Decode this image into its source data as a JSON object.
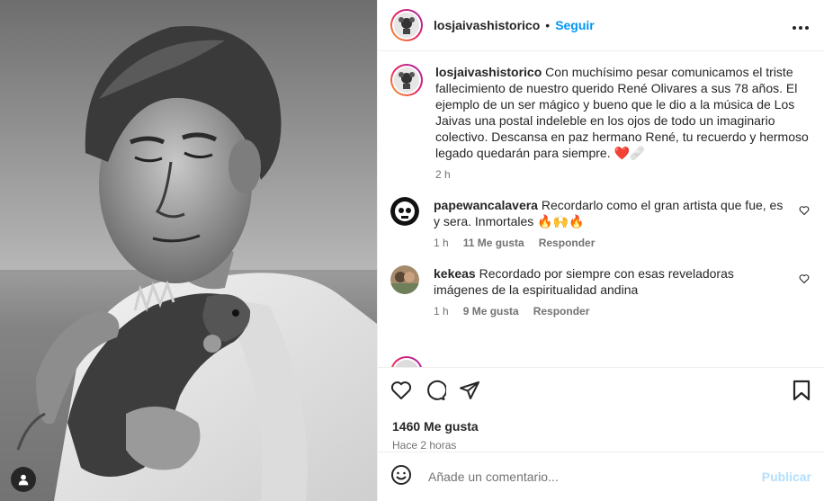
{
  "post": {
    "author": "losjaivashistorico",
    "follow_label": "Seguir",
    "separator": "•",
    "caption": "Con muchísimo pesar comunicamos el triste fallecimiento de nuestro querido René Olivares a sus 78 años. El ejemplo de un ser mágico y bueno que le dio a la música de Los Jaivas una postal indeleble en los ojos de todo un imaginario colectivo. Descansa en paz hermano René, tu recuerdo y hermoso legado quedarán para siempre. ❤️🩹",
    "caption_time": "2 h"
  },
  "comments": [
    {
      "user": "papewancalavera",
      "text": "Recordarlo como el gran artista que fue, es y sera. Inmortales 🔥🙌🔥",
      "time": "1 h",
      "likes": "11 Me gusta",
      "reply": "Responder"
    },
    {
      "user": "kekeas",
      "text": "Recordado por siempre con esas reveladoras imágenes de la espiritualidad andina",
      "time": "1 h",
      "likes": "9 Me gusta",
      "reply": "Responder"
    }
  ],
  "stats": {
    "likes": "1460 Me gusta",
    "posted": "Hace 2 horas"
  },
  "composer": {
    "placeholder": "Añade un comentario...",
    "publish": "Publicar"
  },
  "icons": {
    "more": "more-options-icon",
    "like": "heart-icon",
    "comment": "comment-icon",
    "share": "paper-plane-icon",
    "save": "bookmark-icon",
    "emoji": "emoji-icon",
    "tag": "user-tag-icon"
  },
  "colors": {
    "link": "#0095f6",
    "publish_disabled": "#b2dffc",
    "muted": "#737373"
  }
}
